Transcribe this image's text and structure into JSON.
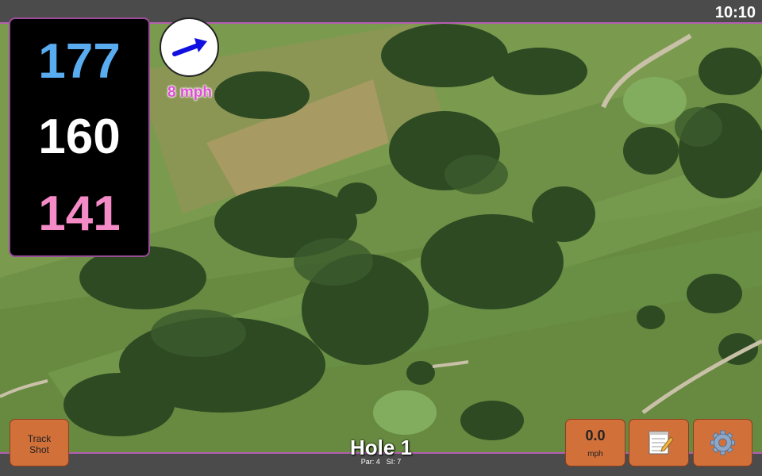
{
  "status": {
    "time": "10:10"
  },
  "yardage": {
    "back": "177",
    "middle": "160",
    "front": "141"
  },
  "wind": {
    "speed": "8 mph",
    "icon": "wind-arrow-icon"
  },
  "hole": {
    "title": "Hole 1",
    "par": "Par: 4",
    "si": "SI: 7"
  },
  "buttons": {
    "track_shot": "Track\nShot",
    "speed_value": "0.0",
    "speed_unit": "mph",
    "notes_icon": "notepad-icon",
    "settings_icon": "gear-icon"
  },
  "colors": {
    "back": "#5aacf0",
    "middle": "#ffffff",
    "front": "#f48ac6",
    "button": "#d2703a",
    "accent_border": "#b35fb0",
    "wind_text": "#e04fd6"
  }
}
